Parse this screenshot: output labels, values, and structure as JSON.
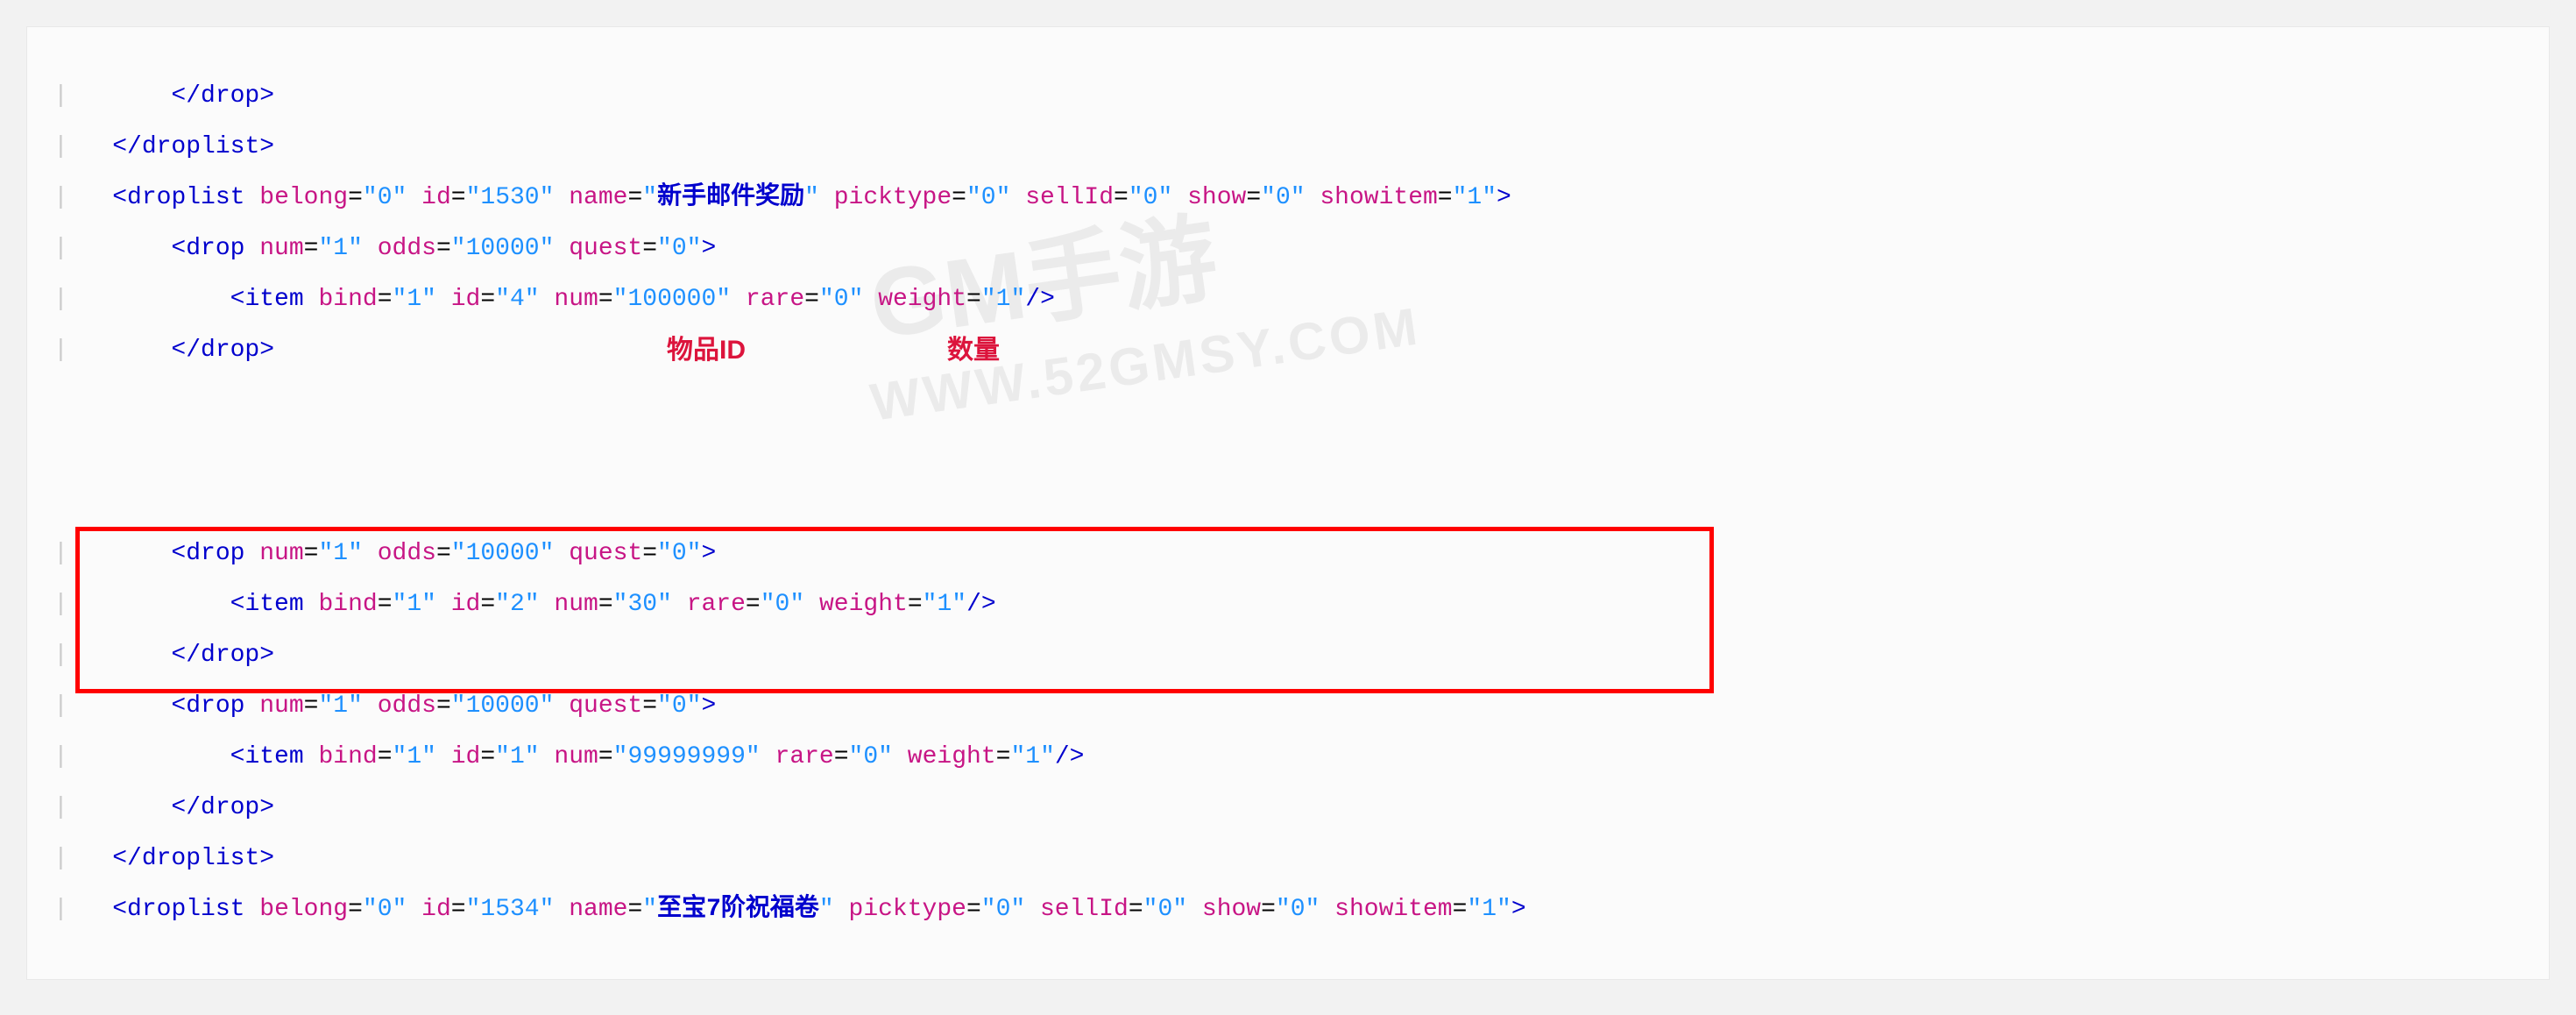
{
  "annotations": {
    "item_id_label": "物品ID",
    "quantity_label": "数量"
  },
  "watermark": {
    "line1": "GM手游",
    "line2": "WWW.52GMSY.COM"
  },
  "code": {
    "l1_close_drop": "</drop>",
    "l2_close_droplist": "</droplist>",
    "dl1": {
      "tag": "droplist",
      "belong": "0",
      "id": "1530",
      "name": "新手邮件奖励",
      "picktype": "0",
      "sellId": "0",
      "show": "0",
      "showitem": "1"
    },
    "drop1": {
      "num": "1",
      "odds": "10000",
      "quest": "0"
    },
    "item1": {
      "bind": "1",
      "id": "4",
      "num": "100000",
      "rare": "0",
      "weight": "1"
    },
    "close_drop1": "</drop>",
    "drop2": {
      "num": "1",
      "odds": "10000",
      "quest": "0"
    },
    "item2": {
      "bind": "1",
      "id": "2",
      "num": "30",
      "rare": "0",
      "weight": "1"
    },
    "close_drop2": "</drop>",
    "drop3": {
      "num": "1",
      "odds": "10000",
      "quest": "0"
    },
    "item3": {
      "bind": "1",
      "id": "1",
      "num": "99999999",
      "rare": "0",
      "weight": "1"
    },
    "close_drop3": "</drop>",
    "close_droplist2": "</droplist>",
    "dl2": {
      "tag": "droplist",
      "belong": "0",
      "id": "1534",
      "name": "至宝7阶祝福卷",
      "picktype": "0",
      "sellId": "0",
      "show": "0",
      "showitem": "1"
    }
  }
}
